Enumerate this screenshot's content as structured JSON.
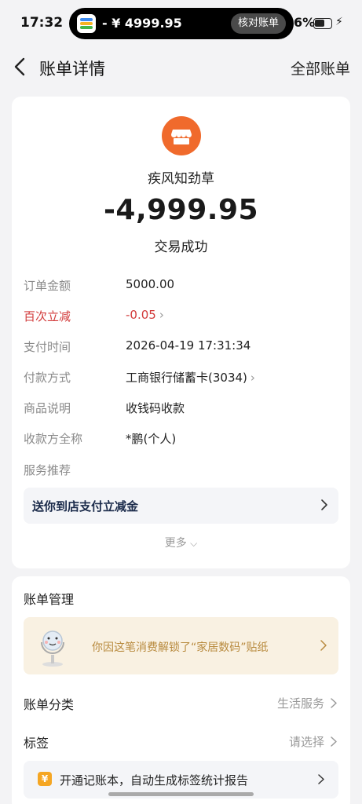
{
  "status_bar": {
    "time": "17:32",
    "island_amount": "- ¥ 4999.95",
    "island_button": "核对账单",
    "battery_pct": "6%"
  },
  "nav": {
    "title": "账单详情",
    "right_link": "全部账单"
  },
  "transaction": {
    "merchant": "疾风知劲草",
    "amount": "-4,999.95",
    "status": "交易成功"
  },
  "details": {
    "order_amount": {
      "label": "订单金额",
      "value": "5000.00"
    },
    "discount": {
      "label": "百次立减",
      "value": "-0.05"
    },
    "pay_time": {
      "label": "支付时间",
      "value": "2026-04-19 17:31:34"
    },
    "pay_method": {
      "label": "付款方式",
      "value": "工商银行储蓄卡(3034)"
    },
    "item_desc": {
      "label": "商品说明",
      "value": "收钱码收款"
    },
    "payee": {
      "label": "收款方全称",
      "value": "*鹏(个人)"
    },
    "service": {
      "label": "服务推荐"
    }
  },
  "promo": {
    "text": "送你到店支付立减金"
  },
  "more_label": "更多",
  "management": {
    "title": "账单管理",
    "sticker_text": "你因这笔消费解锁了“家居数码”贴纸",
    "category": {
      "label": "账单分类",
      "value": "生活服务"
    },
    "tag": {
      "label": "标签",
      "value": "请选择"
    },
    "note_bar": {
      "icon": "¥",
      "text": "开通记账本，自动生成标签统计报告"
    }
  },
  "colors": {
    "accent_orange": "#f06a2c",
    "discount_red": "#d23a3a",
    "sticker_bg": "#f9f1e2",
    "sticker_text": "#b88a3e"
  }
}
